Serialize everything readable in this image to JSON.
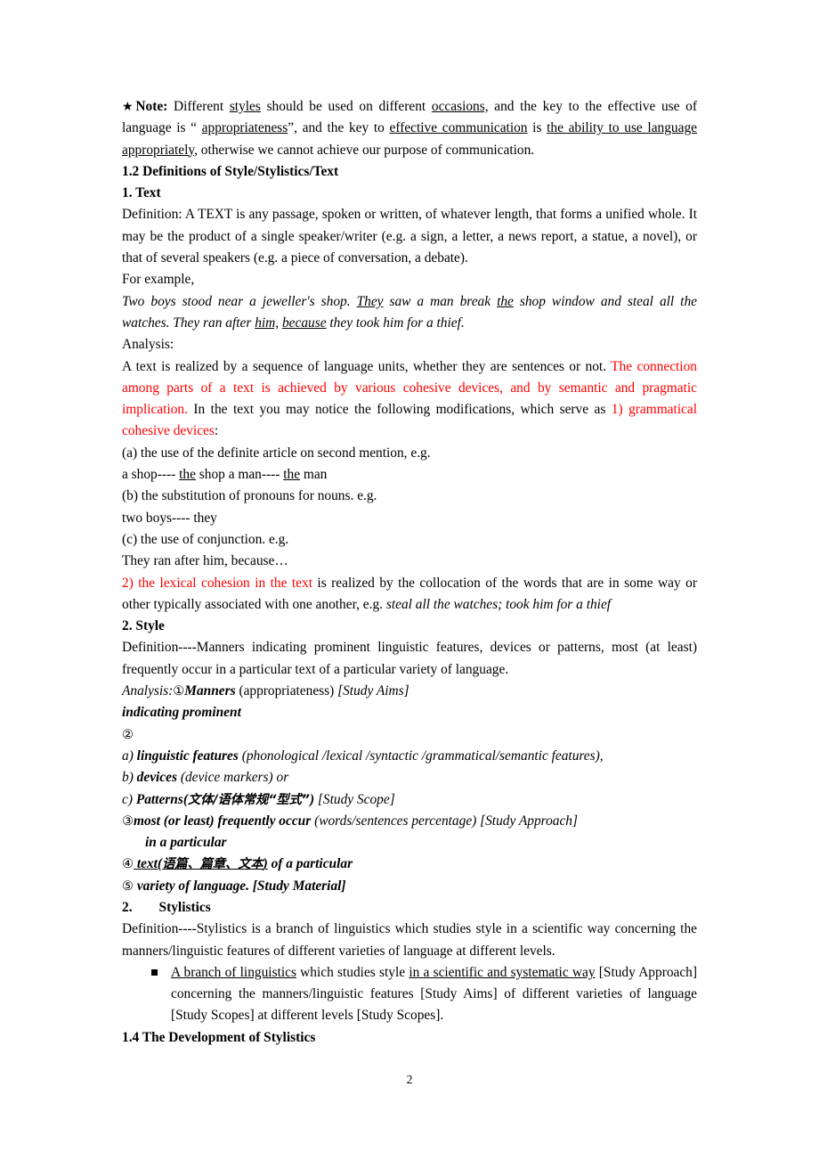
{
  "document": {
    "page_number": "2",
    "accent_red": "#FF0000",
    "text_color": "#000000",
    "background": "#FFFFFF"
  },
  "blocks": {
    "note": {
      "star": "★",
      "label": "Note:",
      "seg1": " Different ",
      "u1": "styles",
      "seg2": " should be used on different ",
      "u2": "occasions,",
      "seg3": " and the key to the effective use of language is  “ ",
      "u3": "appropriateness",
      "seg4": "”, and the key to ",
      "u4": "effective communication",
      "seg5": " is ",
      "u5": "the ability to use language appropriately",
      "seg6": ", otherwise we cannot achieve our purpose of communication."
    },
    "heading_12": "1.2 Definitions of Style/Stylistics/Text",
    "heading_text": "1. Text",
    "text_definition": "Definition: A TEXT is any passage, spoken or written, of whatever length, that forms a unified whole. It may be the product of a single speaker/writer (e.g. a sign, a letter, a news report, a statue, a novel), or that of several speakers (e.g. a piece of conversation, a debate).",
    "for_example": "For example,",
    "example": {
      "seg1": "Two boys stood near a jeweller's shop. ",
      "u1": "They",
      "seg2": " saw a man break ",
      "u2": "the",
      "seg3": " shop window and steal all the watches. They ran after ",
      "u3": "him,",
      "seg4": " ",
      "u4": "because",
      "seg5": " they took him for a thief."
    },
    "analysis_label": "Analysis:",
    "analysis_para": {
      "black1": "A text is realized by a sequence of language units, whether they are sentences or not. ",
      "red1": "The connection among parts of a text is achieved by various cohesive devices, and by semantic and pragmatic implication.",
      "black2": " In the text you may notice the following modifications, which serve as ",
      "red2": "1) grammatical cohesive devices",
      "black3": ":"
    },
    "item_a": "(a) the use of the definite article on second mention, e.g.",
    "shop_line": {
      "seg1": "a shop---- ",
      "u1": "the",
      "seg2": " shop     a man---- ",
      "u2": "the",
      "seg3": " man"
    },
    "item_b": "(b) the substitution of pronouns for nouns. e.g.",
    "two_boys": "two boys---- they",
    "item_c": "(c) the use of conjunction. e.g.",
    "they_ran": "They ran after him, because…",
    "lexical": {
      "red1": "2) the lexical cohesion in the text",
      "black1": " is realized by the collocation of the words that are in some way or other typically associated with one another, e.g. ",
      "italic1": "steal all the watches; took him for a thief"
    },
    "heading_style": "2. Style",
    "style_definition": "Definition----Manners indicating prominent linguistic features, devices or patterns, most (at least) frequently occur in a particular text of a particular variety of language.",
    "analysis_lines": {
      "l1_analysis": "Analysis:",
      "l1_circle": "①",
      "l1_bold": "Manners",
      "l1_rest": " (appropriateness) ",
      "l1_tail": "[Study Aims]",
      "l2": "indicating prominent",
      "l3_circle": "②",
      "l4_label": "a) ",
      "l4_bold": "linguistic features",
      "l4_rest": " (phonological /lexical /syntactic /grammatical/semantic features),",
      "l5_label": "b) ",
      "l5_bold": "devices",
      "l5_rest": " (device markers) or",
      "l6_label": "c) ",
      "l6_bold": "Patterns(",
      "l6_cn": "文体/语体常规“型式”",
      "l6_bold2": ")",
      "l6_tail": " [Study Scope]",
      "l7_circle": "③",
      "l7_bold": "most (or least) frequently occur",
      "l7_rest": " (words/sentences percentage) ",
      "l7_tail": "[Study Approach]",
      "l8": "in a particular",
      "l9_circle": "④",
      "l9_bold": " text(",
      "l9_cn": "语篇、篇章、文本",
      "l9_bold2": ")",
      "l9_rest": " of a particular",
      "l10_circle": "⑤",
      "l10_rest": " variety of language. [Study Material]"
    },
    "heading_stylistics_num": "2.",
    "heading_stylistics": "Stylistics",
    "stylistics_definition": "Definition----Stylistics is a branch of linguistics which studies style in a scientific way concerning the manners/linguistic features of different varieties of language at different levels.",
    "bullet": {
      "u1": "A branch of linguistics",
      "seg1": " which studies style ",
      "u2": "in a scientific and systematic way",
      "seg2": " [Study Approach] concerning the manners/linguistic features [Study Aims] of different varieties of language [Study Scopes] at different levels [Study Scopes]."
    },
    "heading_14": "1.4 The Development of Stylistics"
  }
}
